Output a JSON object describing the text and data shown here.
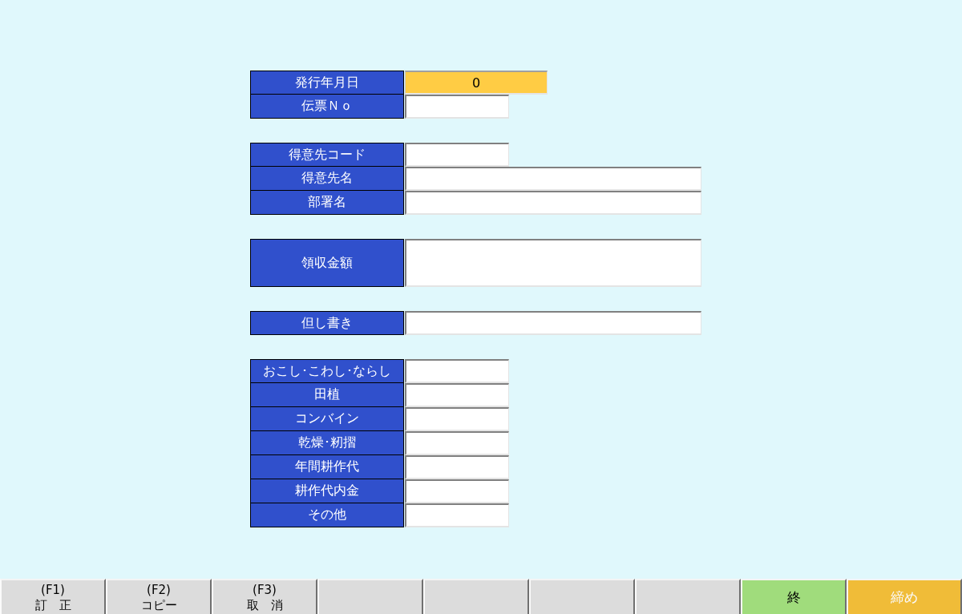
{
  "form": {
    "groups": [
      {
        "rows": [
          {
            "label": "発行年月日",
            "field": {
              "kind": "date",
              "value": "0",
              "focused": true
            }
          },
          {
            "label": "伝票Ｎｏ",
            "field": {
              "kind": "short",
              "focused": false
            }
          }
        ]
      },
      {
        "rows": [
          {
            "label": "得意先コード",
            "field": {
              "kind": "short",
              "focused": false
            }
          },
          {
            "label": "得意先名",
            "field": {
              "kind": "long",
              "focused": false
            }
          },
          {
            "label": "部署名",
            "field": {
              "kind": "long",
              "focused": false
            }
          }
        ]
      },
      {
        "rows": [
          {
            "label": "領収金額",
            "field": {
              "kind": "large",
              "focused": false
            }
          }
        ]
      },
      {
        "rows": [
          {
            "label": "但し書き",
            "field": {
              "kind": "long",
              "focused": false
            }
          }
        ]
      },
      {
        "rows": [
          {
            "label": "おこし･こわし･ならし",
            "field": {
              "kind": "short",
              "focused": false
            }
          },
          {
            "label": "田植",
            "field": {
              "kind": "short",
              "focused": false
            }
          },
          {
            "label": "コンバイン",
            "field": {
              "kind": "short",
              "focused": false
            }
          },
          {
            "label": "乾燥･籾摺",
            "field": {
              "kind": "short",
              "focused": false
            }
          },
          {
            "label": "年間耕作代",
            "field": {
              "kind": "short",
              "focused": false
            }
          },
          {
            "label": "耕作代内金",
            "field": {
              "kind": "short",
              "focused": false
            }
          },
          {
            "label": "その他",
            "field": {
              "kind": "short",
              "focused": false
            }
          }
        ]
      }
    ]
  },
  "function_keys": [
    {
      "kind": "fkey",
      "key": "(F1)",
      "label": "訂　正",
      "color": "#dcdcdc",
      "disabled": false
    },
    {
      "kind": "fkey",
      "key": "(F2)",
      "label": "コピー",
      "color": "#dcdcdc",
      "disabled": false
    },
    {
      "kind": "fkey",
      "key": "(F3)",
      "label": "取　消",
      "color": "#dcdcdc",
      "disabled": false
    },
    {
      "kind": "blank",
      "color": "#dcdcdc"
    },
    {
      "kind": "blank",
      "color": "#dcdcdc"
    },
    {
      "kind": "blank",
      "color": "#dcdcdc"
    },
    {
      "kind": "blank",
      "color": "#dcdcdc"
    },
    {
      "kind": "action",
      "label": "終",
      "color": "#a0dc7c",
      "disabled": false
    },
    {
      "kind": "action",
      "label": "締め",
      "color": "#f0bc38",
      "disabled": true
    }
  ]
}
